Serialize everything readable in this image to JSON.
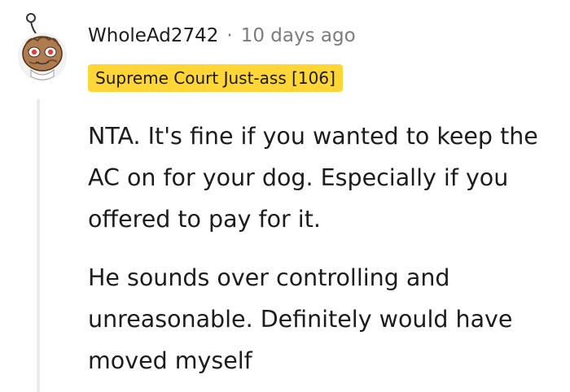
{
  "comment": {
    "username": "WholeAd2742",
    "separator": "·",
    "timestamp": "10 days ago",
    "flair": "Supreme Court Just-ass [106]",
    "paragraphs": [
      "NTA. It's fine if you wanted to keep the AC on for your dog. Especially if you offered to pay for it.",
      "He sounds over controlling and unreasonable. Definitely would have moved myself"
    ]
  },
  "colors": {
    "flair_background": "#ffd635",
    "timestamp": "#7c7c7c",
    "thread_line": "#e9ecee",
    "avatar_face": "#b07c4f",
    "avatar_eyes": "#e8402e"
  },
  "icons": {
    "avatar": "reddit-snoo-avatar"
  }
}
